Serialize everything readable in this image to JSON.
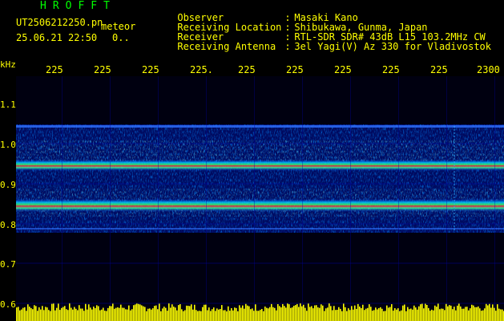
{
  "header": {
    "brand": "HROFFT",
    "filename": "UT2506212250.pn",
    "meteor_label": "meteor",
    "datetime": "25.06.21 22:50",
    "dots": "0.."
  },
  "info": [
    {
      "label": "Observer",
      "value": "Masaki Kano"
    },
    {
      "label": "Receiving Location",
      "value": "Shibukawa, Gunma, Japan"
    },
    {
      "label": "Receiver",
      "value": "RTL-SDR SDR# 43dB L15 103.2MHz CW"
    },
    {
      "label": "Receiving Antenna",
      "value": "3el Yagi(V) Az 330 for Vladivostok"
    }
  ],
  "axis": {
    "unit": "kHz",
    "time_ticks": [
      "225",
      "225",
      "225",
      "225.",
      "225",
      "225",
      "225",
      "225",
      "225",
      "2300"
    ],
    "freq_ticks": [
      "1.1",
      "1.0",
      "0.9",
      "0.8",
      "0.7",
      "0.6"
    ]
  },
  "colors": {
    "label": "#ffff00",
    "brand": "#00ff00",
    "background": "#000000",
    "noise_bar": "#ffff00"
  }
}
